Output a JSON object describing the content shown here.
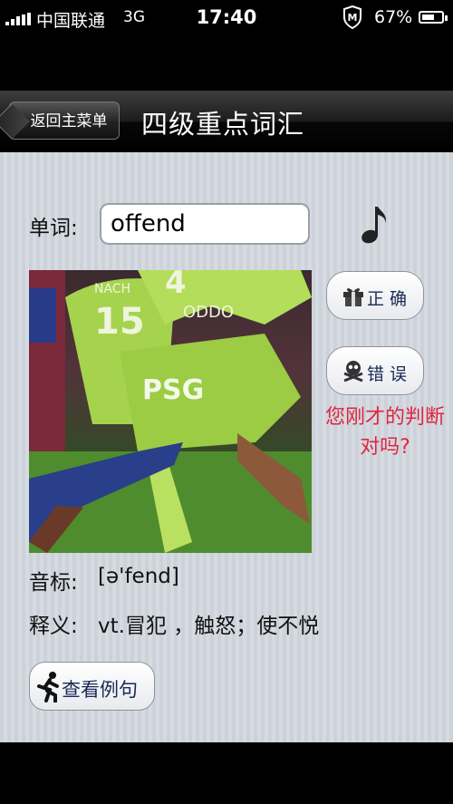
{
  "status_bar": {
    "carrier": "中国联通",
    "network": "3G",
    "time": "17:40",
    "battery": "67%",
    "battery_level": 0.67
  },
  "nav": {
    "back_label": "返回主菜单",
    "title": "四级重点词汇"
  },
  "word": {
    "label": "单词:",
    "value": "offend"
  },
  "buttons": {
    "correct": "正 确",
    "wrong": "错 误",
    "example": "查看例句"
  },
  "prompt": "您刚才的判断对吗?",
  "phonetic": {
    "label": "音标:",
    "value": "[ə'fend]"
  },
  "definition": {
    "label": "释义:",
    "value": "vt.冒犯 ，触怒；使不悦"
  },
  "photo": {
    "jersey_numbers": [
      "15",
      "4"
    ],
    "team": "PSG",
    "sponsor": "ODDO",
    "maker": "NACH"
  },
  "colors": {
    "accent_red": "#e0253f",
    "button_text": "#1a2a55"
  }
}
